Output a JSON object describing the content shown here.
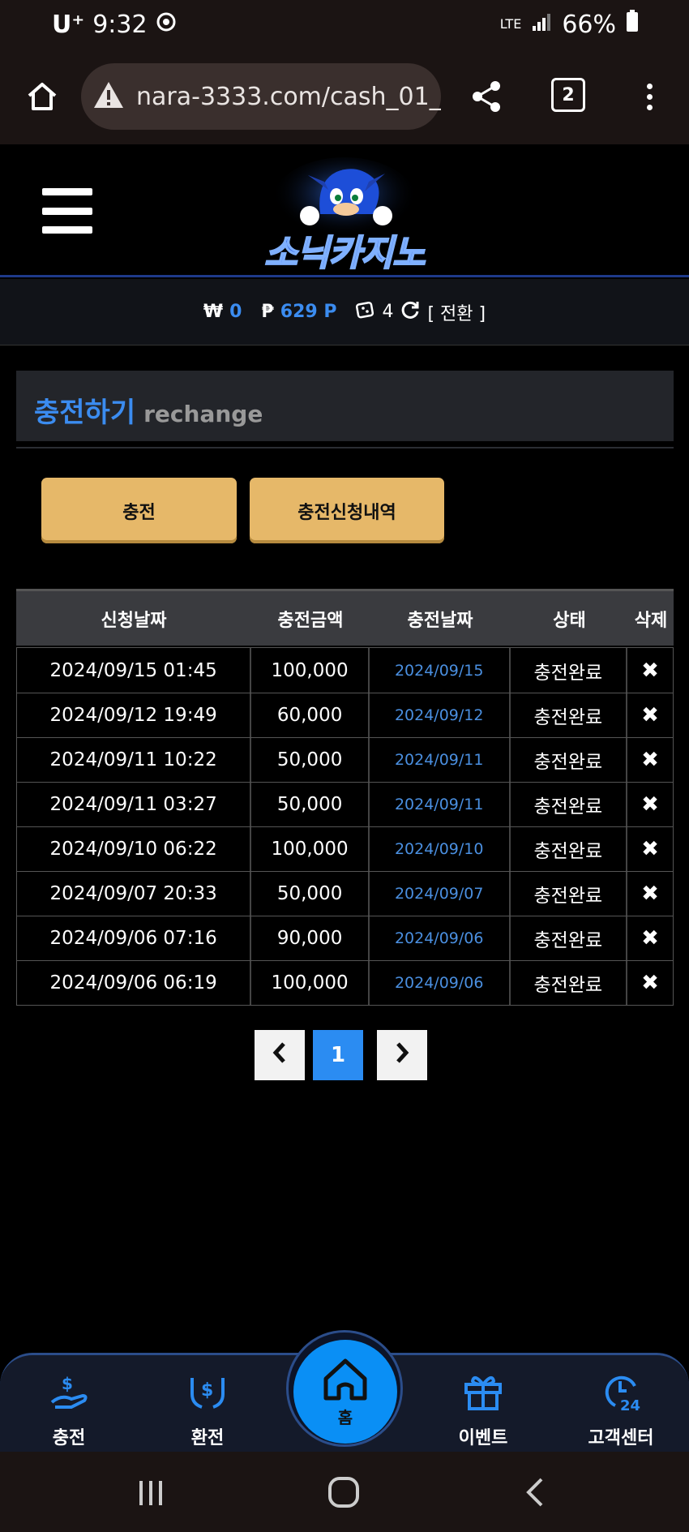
{
  "status_bar": {
    "carrier": "U⁺",
    "time": "9:32",
    "network": "LTE",
    "battery": "66%"
  },
  "browser": {
    "url": "nara-3333.com/cash_01_1.",
    "tab_count": "2"
  },
  "site": {
    "logo_text": "소닉카지노"
  },
  "balance": {
    "won_symbol": "₩",
    "won_value": "0",
    "point_symbol": "₱",
    "point_value": "629 P",
    "chip_value": "4",
    "convert_label": "[ 전환 ]"
  },
  "section": {
    "title": "충전하기",
    "subtitle": "rechange"
  },
  "buttons": {
    "charge": "충전",
    "history": "충전신청내역"
  },
  "table": {
    "headers": [
      "신청날짜",
      "충전금액",
      "충전날짜",
      "상태",
      "삭제"
    ],
    "rows": [
      {
        "request_date": "2024/09/15 01:45",
        "amount": "100,000",
        "charge_date": "2024/09/15",
        "status": "충전완료",
        "delete": "✖"
      },
      {
        "request_date": "2024/09/12 19:49",
        "amount": "60,000",
        "charge_date": "2024/09/12",
        "status": "충전완료",
        "delete": "✖"
      },
      {
        "request_date": "2024/09/11 10:22",
        "amount": "50,000",
        "charge_date": "2024/09/11",
        "status": "충전완료",
        "delete": "✖"
      },
      {
        "request_date": "2024/09/11 03:27",
        "amount": "50,000",
        "charge_date": "2024/09/11",
        "status": "충전완료",
        "delete": "✖"
      },
      {
        "request_date": "2024/09/10 06:22",
        "amount": "100,000",
        "charge_date": "2024/09/10",
        "status": "충전완료",
        "delete": "✖"
      },
      {
        "request_date": "2024/09/07 20:33",
        "amount": "50,000",
        "charge_date": "2024/09/07",
        "status": "충전완료",
        "delete": "✖"
      },
      {
        "request_date": "2024/09/06 07:16",
        "amount": "90,000",
        "charge_date": "2024/09/06",
        "status": "충전완료",
        "delete": "✖"
      },
      {
        "request_date": "2024/09/06 06:19",
        "amount": "100,000",
        "charge_date": "2024/09/06",
        "status": "충전완료",
        "delete": "✖"
      }
    ]
  },
  "pagination": {
    "current_page": "1"
  },
  "bottom_nav": {
    "charge": "충전",
    "exchange": "환전",
    "home": "홈",
    "event": "이벤트",
    "support": "고객센터"
  },
  "colors": {
    "accent_blue": "#3b8cf0",
    "button_gold": "#e6b869",
    "home_blue": "#0a8ff5"
  }
}
